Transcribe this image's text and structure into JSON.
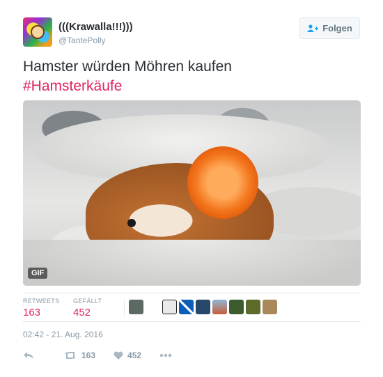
{
  "user": {
    "display_name": "(((Krawalla!!!)))",
    "handle": "@TantePolly",
    "avatar": "colorful-avatar"
  },
  "follow_button": {
    "label": "Folgen",
    "icon": "add-user-icon"
  },
  "tweet": {
    "text": "Hamster würden Möhren kaufen",
    "hashtag": "#Hamsterkäufe",
    "media": {
      "badge": "GIF",
      "description_icon": "hamster-gif"
    }
  },
  "stats": {
    "retweets_label": "RETWEETS",
    "retweets_value": "163",
    "likes_label": "GEFÄLLT",
    "likes_value": "452",
    "favers_count_shown": 9
  },
  "timestamp": "02:42 - 21. Aug. 2016",
  "actions": {
    "reply_icon": "reply-icon",
    "retweet_count": "163",
    "like_count": "452",
    "more_icon": "more-icon"
  },
  "colors": {
    "hashtag": "#e0245e",
    "stat_value": "#e0245e",
    "muted": "#8899a6",
    "text": "#292f33",
    "border": "#e1e8ed"
  }
}
